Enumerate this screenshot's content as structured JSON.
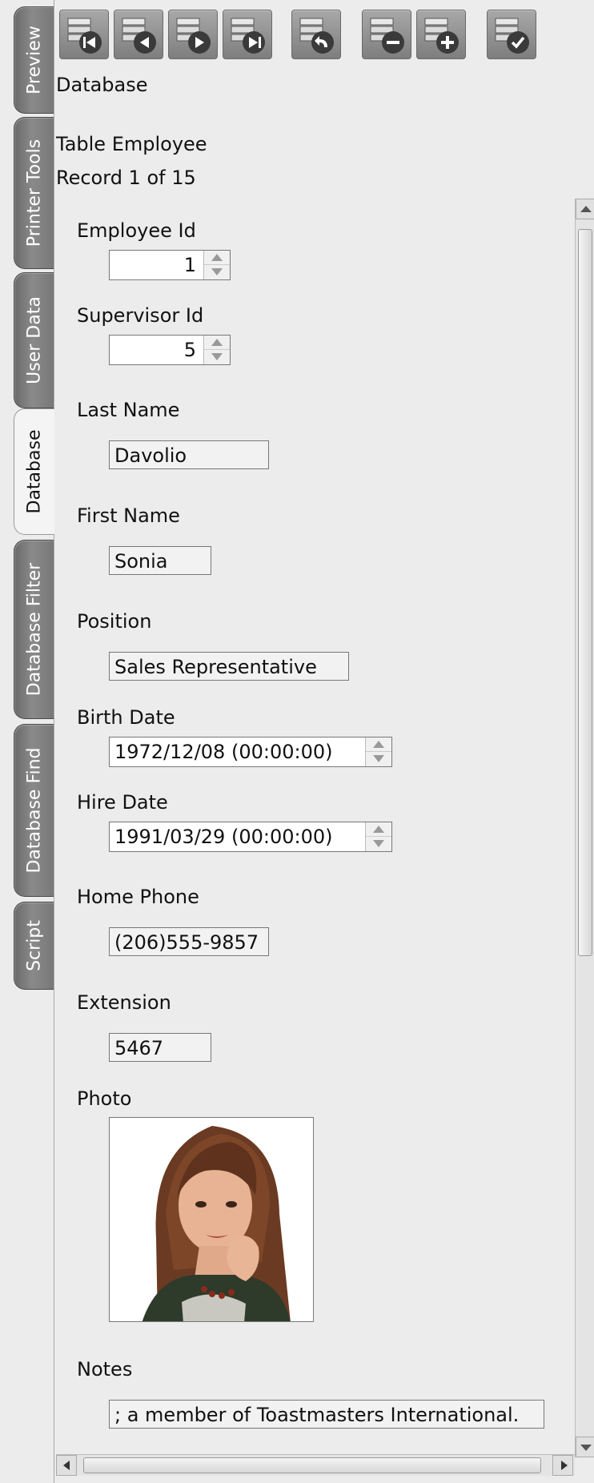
{
  "tabs": [
    {
      "label": "Preview",
      "active": false
    },
    {
      "label": "Printer Tools",
      "active": false
    },
    {
      "label": "User Data",
      "active": false
    },
    {
      "label": "Database",
      "active": true
    },
    {
      "label": "Database Filter",
      "active": false
    },
    {
      "label": "Database Find",
      "active": false
    },
    {
      "label": "Script",
      "active": false
    }
  ],
  "toolbar": {
    "buttons": [
      "first-record-icon",
      "previous-record-icon",
      "next-record-icon",
      "last-record-icon",
      "undo-record-icon",
      "delete-record-icon",
      "add-record-icon",
      "post-record-icon"
    ]
  },
  "header": {
    "section_title": "Database",
    "table_name": "Table Employee",
    "record_position": "Record 1 of 15"
  },
  "form": {
    "employee_id": {
      "label": "Employee Id",
      "value": "1"
    },
    "supervisor_id": {
      "label": "Supervisor Id",
      "value": "5"
    },
    "last_name": {
      "label": "Last Name",
      "value": "Davolio"
    },
    "first_name": {
      "label": "First Name",
      "value": "Sonia"
    },
    "position": {
      "label": "Position",
      "value": "Sales Representative"
    },
    "birth_date": {
      "label": "Birth Date",
      "value": "1972/12/08 (00:00:00)"
    },
    "hire_date": {
      "label": "Hire Date",
      "value": "1991/03/29 (00:00:00)"
    },
    "home_phone": {
      "label": "Home Phone",
      "value": "(206)555-9857"
    },
    "extension": {
      "label": "Extension",
      "value": "5467"
    },
    "photo": {
      "label": "Photo"
    },
    "notes": {
      "label": "Notes",
      "value": "; a member of Toastmasters International."
    }
  },
  "colors": {
    "tab_inactive": "#7a7a7a",
    "tab_active": "#f4f4f4",
    "toolbar_button": "#8e8e8e",
    "background": "#ececec"
  }
}
